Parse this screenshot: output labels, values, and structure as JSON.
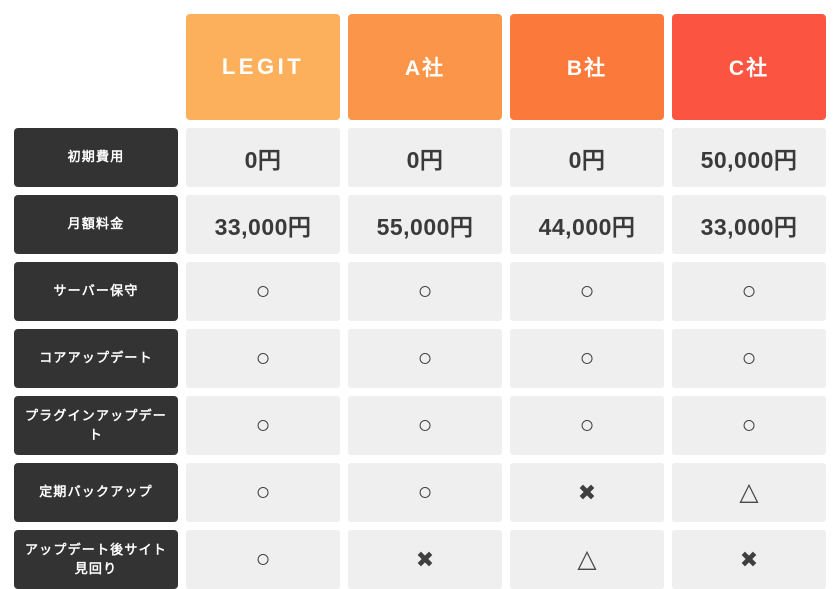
{
  "table": {
    "header": {
      "label_column": "",
      "columns": [
        {
          "label": "LEGIT",
          "color": "#fdb05c",
          "is_brand": true
        },
        {
          "label": "A社",
          "color": "#fb9549",
          "is_brand": false
        },
        {
          "label": "B社",
          "color": "#fb793b",
          "is_brand": false
        },
        {
          "label": "C社",
          "color": "#fb5441",
          "is_brand": false
        }
      ]
    },
    "rows": [
      {
        "label": "初期費用",
        "type": "text",
        "values": [
          "0円",
          "0円",
          "0円",
          "50,000円"
        ]
      },
      {
        "label": "月額料金",
        "type": "text",
        "values": [
          "33,000円",
          "55,000円",
          "44,000円",
          "33,000円"
        ]
      },
      {
        "label": "サーバー保守",
        "type": "symbol",
        "values": [
          "○",
          "○",
          "○",
          "○"
        ]
      },
      {
        "label": "コアアップデート",
        "type": "symbol",
        "values": [
          "○",
          "○",
          "○",
          "○"
        ]
      },
      {
        "label": "プラグインアップデート",
        "type": "symbol",
        "values": [
          "○",
          "○",
          "○",
          "○"
        ]
      },
      {
        "label": "定期バックアップ",
        "type": "symbol",
        "values": [
          "○",
          "○",
          "✖",
          "△"
        ]
      },
      {
        "label": "アップデート後サイト見回り",
        "type": "symbol",
        "values": [
          "○",
          "✖",
          "△",
          "✖"
        ]
      }
    ],
    "symbol_legend": {
      "circle": "○",
      "cross": "✖",
      "triangle": "△"
    },
    "style": {
      "label_background": "#333333",
      "cell_background": "#efefef",
      "cell_text": "#3a3a3a",
      "page_background": "#ffffff"
    }
  }
}
